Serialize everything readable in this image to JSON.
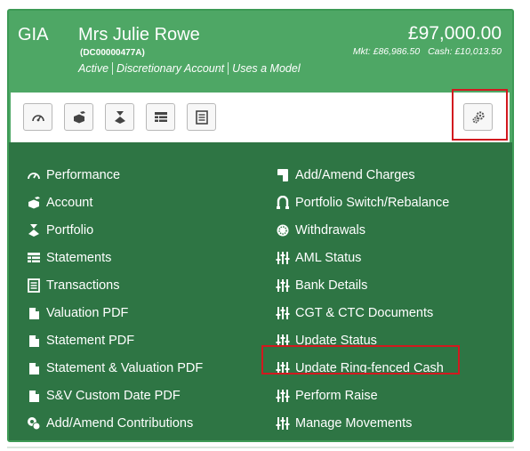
{
  "header": {
    "account_type": "GIA",
    "client_name": "Mrs Julie Rowe",
    "client_ref": "(DC00000477A)",
    "tags": [
      "Active",
      "Discretionary Account",
      "Uses a Model"
    ],
    "total_value": "£97,000.00",
    "market_value": "Mkt: £86,986.50",
    "cash_value": "Cash: £10,013.50"
  },
  "colors": {
    "header_green": "#4ea765",
    "menu_green": "#2e7544",
    "highlight_red": "#d2191f"
  },
  "toolbar": {
    "buttons": [
      {
        "icon": "dashboard-icon"
      },
      {
        "icon": "cubes-icon"
      },
      {
        "icon": "funnel-icon"
      },
      {
        "icon": "table-icon"
      },
      {
        "icon": "ledger-icon"
      }
    ],
    "settings_icon": "cogs-icon"
  },
  "menu": {
    "left": [
      {
        "label": "Performance",
        "icon": "dashboard-icon"
      },
      {
        "label": "Account",
        "icon": "cubes-icon"
      },
      {
        "label": "Portfolio",
        "icon": "funnel-icon"
      },
      {
        "label": "Statements",
        "icon": "table-icon"
      },
      {
        "label": "Transactions",
        "icon": "ledger-icon"
      },
      {
        "label": "Valuation PDF",
        "icon": "file-icon"
      },
      {
        "label": "Statement PDF",
        "icon": "file-icon"
      },
      {
        "label": "Statement & Valuation PDF",
        "icon": "file-icon"
      },
      {
        "label": "S&V Custom Date PDF",
        "icon": "file-icon"
      },
      {
        "label": "Add/Amend Contributions",
        "icon": "coins-icon"
      }
    ],
    "right": [
      {
        "label": "Add/Amend Charges",
        "icon": "charges-icon"
      },
      {
        "label": "Portfolio Switch/Rebalance",
        "icon": "switch-icon"
      },
      {
        "label": "Withdrawals",
        "icon": "withdraw-icon"
      },
      {
        "label": "AML Status",
        "icon": "sliders-icon"
      },
      {
        "label": "Bank Details",
        "icon": "sliders-icon"
      },
      {
        "label": "CGT & CTC Documents",
        "icon": "sliders-icon"
      },
      {
        "label": "Update Status",
        "icon": "sliders-icon"
      },
      {
        "label": "Update Ring-fenced Cash",
        "icon": "sliders-icon"
      },
      {
        "label": "Perform Raise",
        "icon": "sliders-icon"
      },
      {
        "label": "Manage Movements",
        "icon": "sliders-icon"
      }
    ]
  }
}
